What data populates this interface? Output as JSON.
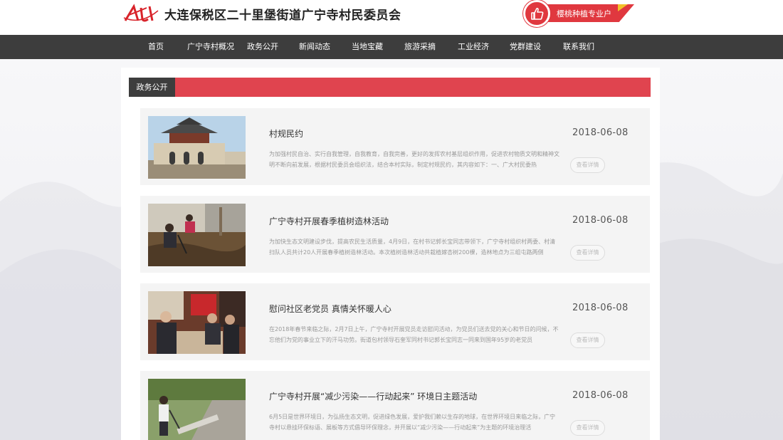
{
  "header": {
    "site_title": "大连保税区二十里堡街道广宁寺村民委员会",
    "promo_text": "樱桃种植专业户",
    "colors": {
      "brand_red": "#e0383f",
      "nav_bg": "#3d3d3d",
      "accent_yellow": "#f3c12a"
    }
  },
  "nav": {
    "items": [
      {
        "label": "首页"
      },
      {
        "label": "广宁寺村概况"
      },
      {
        "label": "政务公开"
      },
      {
        "label": "新闻动态"
      },
      {
        "label": "当地宝藏"
      },
      {
        "label": "旅游采摘"
      },
      {
        "label": "工业经济"
      },
      {
        "label": "党群建设"
      },
      {
        "label": "联系我们"
      }
    ]
  },
  "section": {
    "title": "政务公开"
  },
  "articles": [
    {
      "title": "村规民约",
      "desc": "为加强村民自治、实行自我管理，自我教育，自我完善，更好的发挥农村基层组织作用，促进农村物质文明和精神文明不断向前发展，根据村民委员会组织法，结合本村实际，制定村规民约，其内容如下：一、广大村民委热",
      "date": "2018-06-08",
      "button": "查看详情",
      "image": "tower-photo"
    },
    {
      "title": "广宁寺村开展春季植树造林活动",
      "desc": "为加快生态文明建设步伐，提高农民生活质量，4月9日，在村书记郭长宝同志带领下，广宁寺村组织村两委、村清扫队人员共计20人开展春季植树造林活动。本次植树造林活动共栽植嫁杏树200棵，造林地点为三组屯路两侧",
      "date": "2018-06-08",
      "button": "查看详情",
      "image": "tree-planting-photo"
    },
    {
      "title": "慰问社区老党员 真情关怀暖人心",
      "desc": "在2018年春节来临之际，2月7日上午，广宁寺村开展党员走访慰问活动，为党员们送去党的关心和节日的问候，不忘他们为党的事业立下的汗马功劳。街道包村领导石奎军同村书记郭长宝同志一同来到国年95岁的老党员",
      "date": "2018-06-08",
      "button": "查看详情",
      "image": "visit-photo"
    },
    {
      "title": "广宁寺村开展“减少污染——行动起来” 环境日主题活动",
      "desc": "6月5日是世界环境日，为弘扬生态文明，促进绿色发展，爱护我们赖以生存的地球，在世界环境日来临之际，广宁寺村以悬挂环保标语、展板等方式倡导环保理念，并开展以“减少污染——行动起来”为主题的环境治理活",
      "date": "2018-06-08",
      "button": "查看详情",
      "image": "cleanup-photo"
    }
  ]
}
